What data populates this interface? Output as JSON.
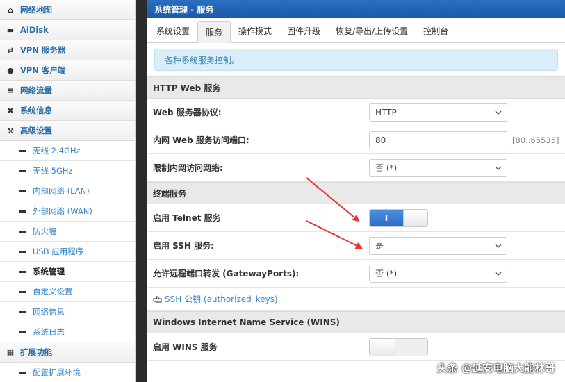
{
  "sidebar": {
    "items": [
      {
        "icon": "home-icon",
        "glyph": "⌂",
        "label": "网络地图"
      },
      {
        "icon": "disk-icon",
        "glyph": "▬",
        "label": "AiDisk"
      },
      {
        "icon": "vpn-server-icon",
        "glyph": "⇄",
        "label": "VPN 服务器"
      },
      {
        "icon": "globe-icon",
        "glyph": "●",
        "label": "VPN 客户端"
      },
      {
        "icon": "traffic-icon",
        "glyph": "≡",
        "label": "网络流量"
      },
      {
        "icon": "shuffle-icon",
        "glyph": "✖",
        "label": "系统信息"
      },
      {
        "icon": "wrench-icon",
        "glyph": "⚒",
        "label": "高级设置"
      }
    ],
    "sub_items": [
      "无线 2.4GHz",
      "无线 5GHz",
      "内部网络 (LAN)",
      "外部网络 (WAN)",
      "防火墙",
      "USB 应用程序",
      "系统管理",
      "自定义设置",
      "网络信息",
      "系统日志"
    ],
    "active_sub": "系统管理",
    "ext_item": {
      "icon": "grid-icon",
      "glyph": "▦",
      "label": "扩展功能"
    },
    "ext_sub_items": [
      "配置扩展环境"
    ]
  },
  "header": {
    "title": "系统管理 - 服务"
  },
  "tabs": [
    "系统设置",
    "服务",
    "操作模式",
    "固件升级",
    "恢复/导出/上传设置",
    "控制台"
  ],
  "active_tab": "服务",
  "info": "各种系统服务控制。",
  "http_section": {
    "title": "HTTP Web 服务",
    "protocol_label": "Web 服务器协议:",
    "protocol_value": "HTTP",
    "port_label": "内网 Web 服务访问端口:",
    "port_value": "80",
    "port_hint": "[80..65535]",
    "restrict_label": "限制内网访问网络:",
    "restrict_value": "否 (*)"
  },
  "terminal_section": {
    "title": "终端服务",
    "telnet_label": "启用 Telnet 服务",
    "telnet_on_text": "I",
    "ssh_label": "启用 SSH 服务:",
    "ssh_value": "是",
    "gateway_label": "允许远程端口转发 (GatewayPorts):",
    "gateway_value": "否 (*)",
    "ssh_keys_link": "SSH 公钥 (authorized_keys)"
  },
  "wins_section": {
    "title": "Windows Internet Name Service (WINS)",
    "wins_label": "启用 WINS 服务"
  },
  "watermark": "头条 @延安电脑大能林哥",
  "colors": {
    "header": "#1d5fb0",
    "accent": "#3a86c4",
    "arrow": "#e8342a"
  }
}
